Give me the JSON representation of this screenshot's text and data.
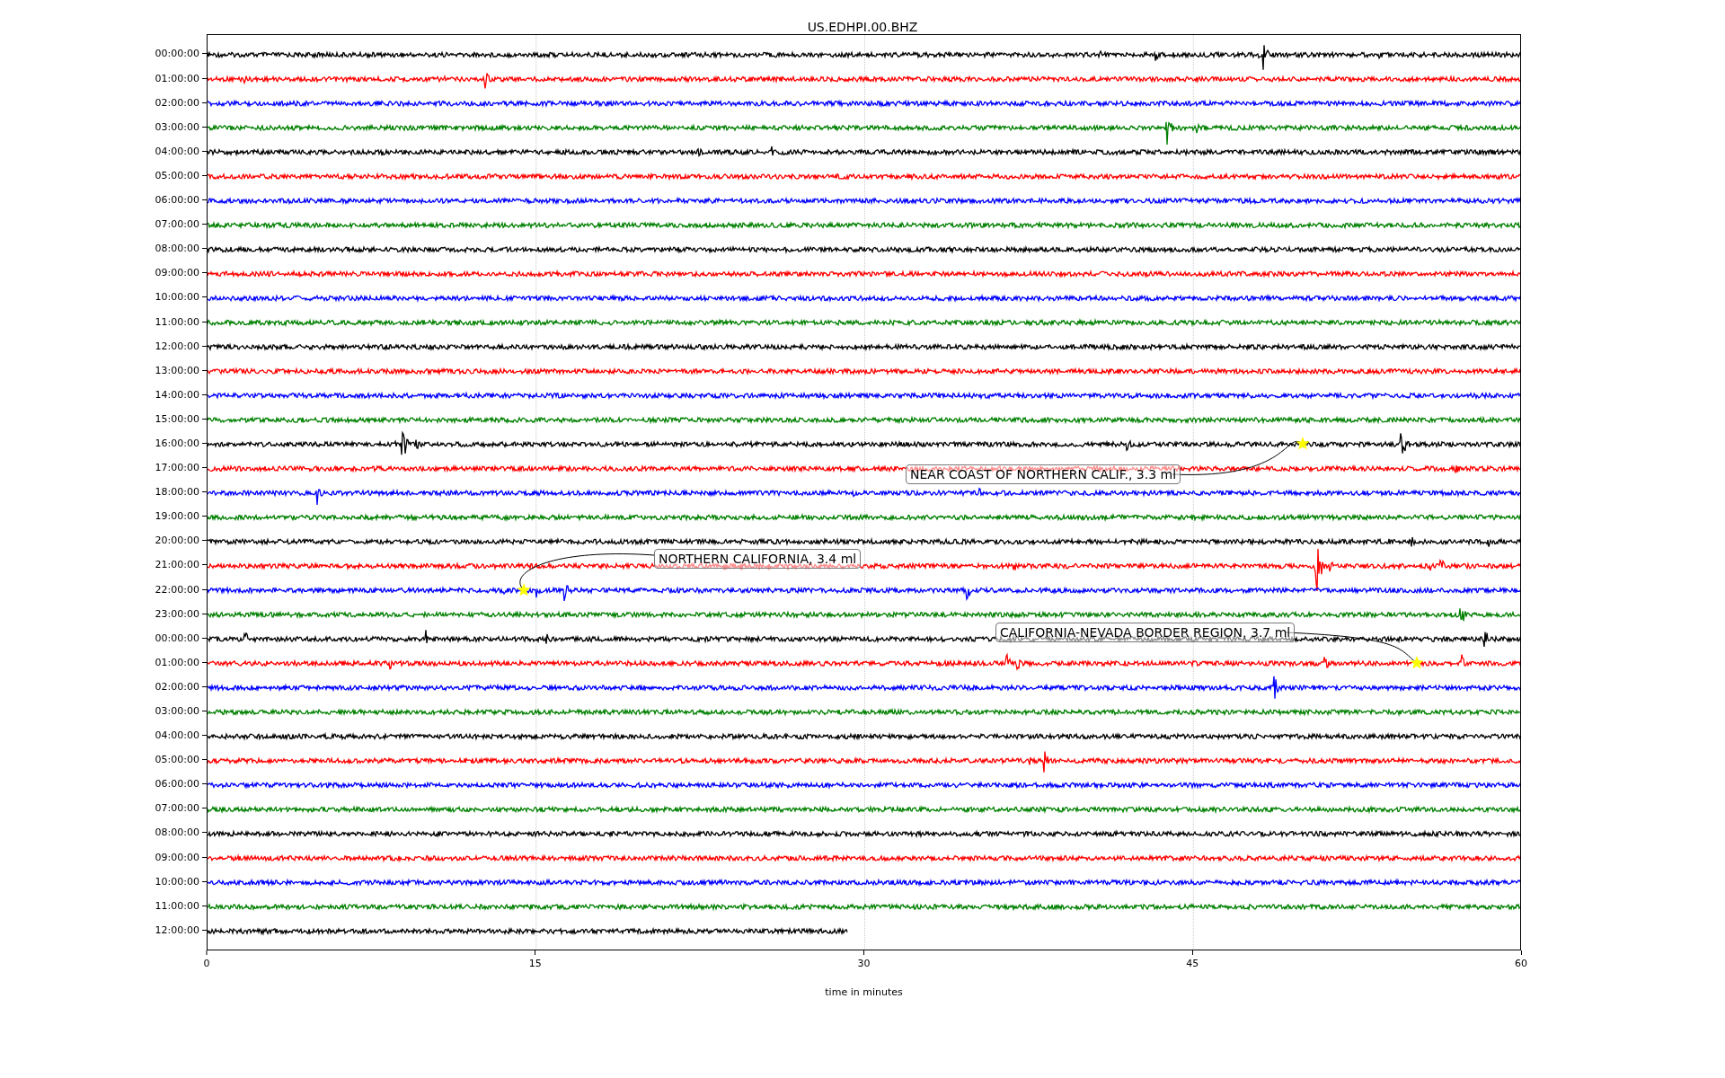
{
  "title": "US.EDHPI.00.BHZ",
  "rows": [
    {
      "label": "00:00:00",
      "color": "#000000"
    },
    {
      "label": "01:00:00",
      "color": "#ff0000"
    },
    {
      "label": "02:00:00",
      "color": "#0000ff"
    },
    {
      "label": "03:00:00",
      "color": "#008000"
    },
    {
      "label": "04:00:00",
      "color": "#000000"
    },
    {
      "label": "05:00:00",
      "color": "#ff0000"
    },
    {
      "label": "06:00:00",
      "color": "#0000ff"
    },
    {
      "label": "07:00:00",
      "color": "#008000"
    },
    {
      "label": "08:00:00",
      "color": "#000000"
    },
    {
      "label": "09:00:00",
      "color": "#ff0000"
    },
    {
      "label": "10:00:00",
      "color": "#0000ff"
    },
    {
      "label": "11:00:00",
      "color": "#008000"
    },
    {
      "label": "12:00:00",
      "color": "#000000"
    },
    {
      "label": "13:00:00",
      "color": "#ff0000"
    },
    {
      "label": "14:00:00",
      "color": "#0000ff"
    },
    {
      "label": "15:00:00",
      "color": "#008000"
    },
    {
      "label": "16:00:00",
      "color": "#000000"
    },
    {
      "label": "17:00:00",
      "color": "#ff0000"
    },
    {
      "label": "18:00:00",
      "color": "#0000ff"
    },
    {
      "label": "19:00:00",
      "color": "#008000"
    },
    {
      "label": "20:00:00",
      "color": "#000000"
    },
    {
      "label": "21:00:00",
      "color": "#ff0000"
    },
    {
      "label": "22:00:00",
      "color": "#0000ff"
    },
    {
      "label": "23:00:00",
      "color": "#008000"
    },
    {
      "label": "00:00:00",
      "color": "#000000"
    },
    {
      "label": "01:00:00",
      "color": "#ff0000"
    },
    {
      "label": "02:00:00",
      "color": "#0000ff"
    },
    {
      "label": "03:00:00",
      "color": "#008000"
    },
    {
      "label": "04:00:00",
      "color": "#000000"
    },
    {
      "label": "05:00:00",
      "color": "#ff0000"
    },
    {
      "label": "06:00:00",
      "color": "#0000ff"
    },
    {
      "label": "07:00:00",
      "color": "#008000"
    },
    {
      "label": "08:00:00",
      "color": "#000000"
    },
    {
      "label": "09:00:00",
      "color": "#ff0000"
    },
    {
      "label": "10:00:00",
      "color": "#0000ff"
    },
    {
      "label": "11:00:00",
      "color": "#008000"
    },
    {
      "label": "12:00:00",
      "color": "#000000"
    }
  ],
  "events": [
    {
      "text": "NEAR COAST OF NORTHERN CALIF., 3.3 ml"
    },
    {
      "text": "NORTHERN CALIFORNIA, 3.4 ml"
    },
    {
      "text": "CALIFORNIA-NEVADA BORDER REGION, 3.7 ml"
    }
  ],
  "x_axis": {
    "label": "time in minutes",
    "ticks": [
      "0",
      "15",
      "30",
      "45",
      "60"
    ]
  }
}
